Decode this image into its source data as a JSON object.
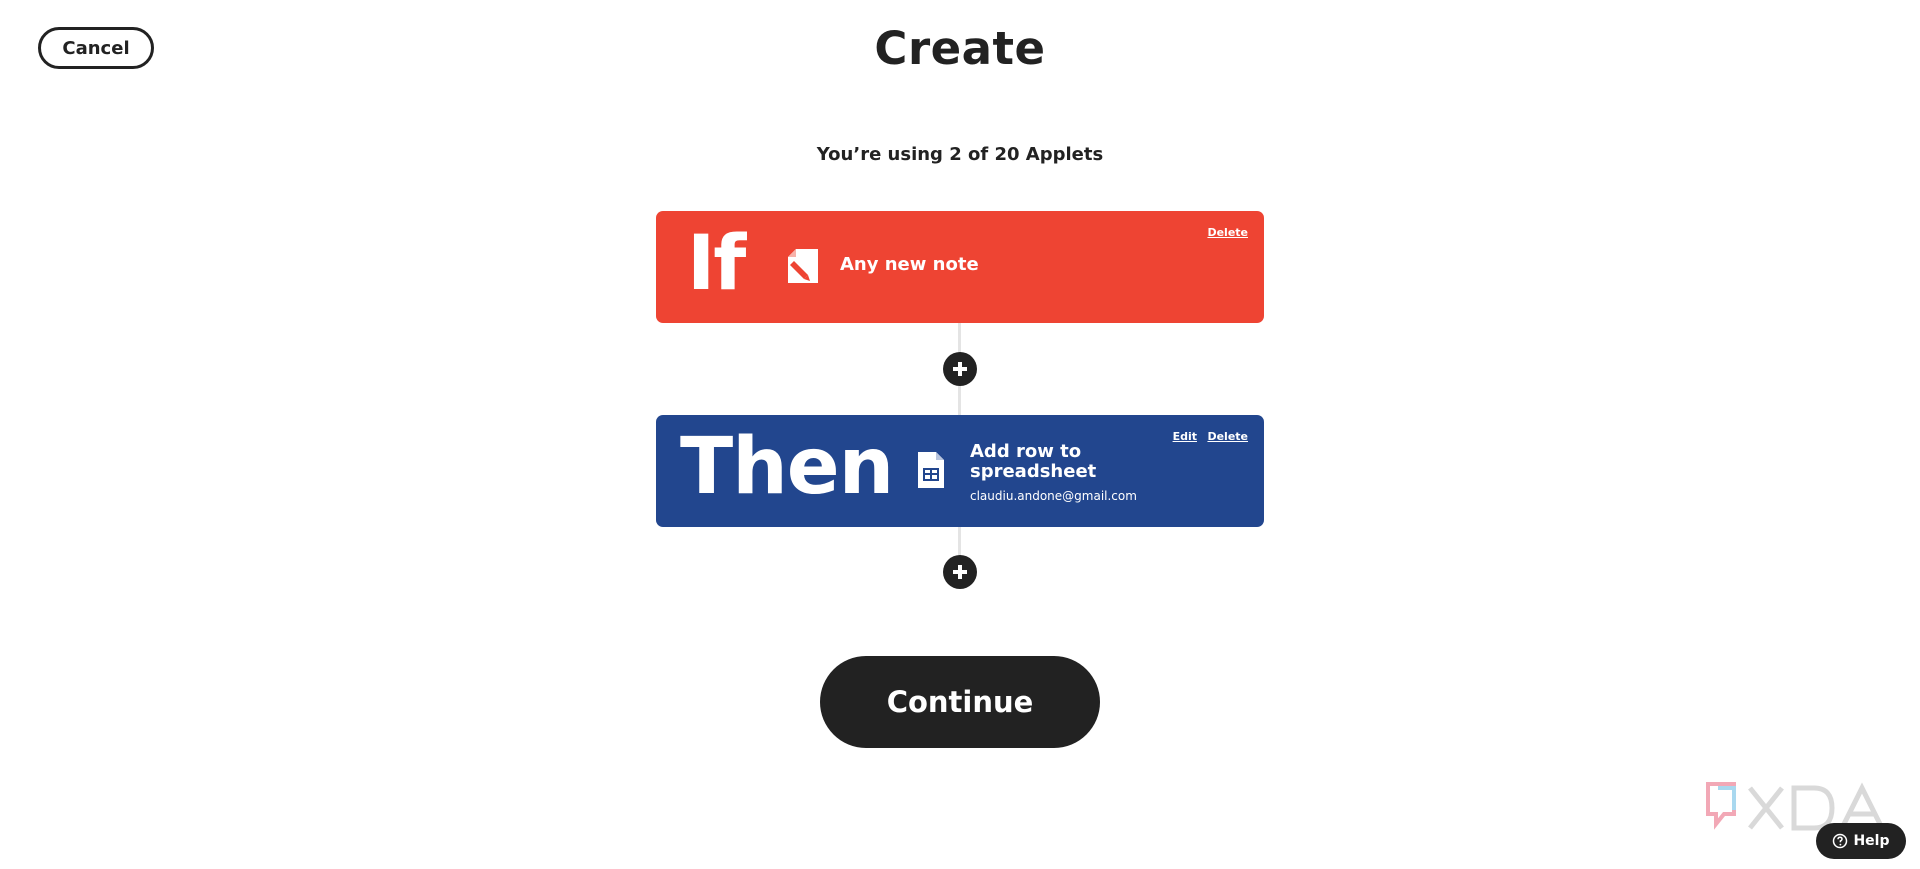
{
  "header": {
    "cancel_label": "Cancel",
    "title": "Create"
  },
  "usage_text": "You’re using 2 of 20 Applets",
  "trigger": {
    "keyword": "If",
    "icon": "note-pencil-icon",
    "title": "Any new note",
    "delete_label": "Delete",
    "color": "#ee4433"
  },
  "action": {
    "keyword": "Then",
    "icon": "spreadsheet-icon",
    "title": "Add row to spreadsheet",
    "account": "claudiu.andone@gmail.com",
    "edit_label": "Edit",
    "delete_label": "Delete",
    "color": "#22468e"
  },
  "continue_label": "Continue",
  "watermark": "XDA",
  "help_label": "Help"
}
